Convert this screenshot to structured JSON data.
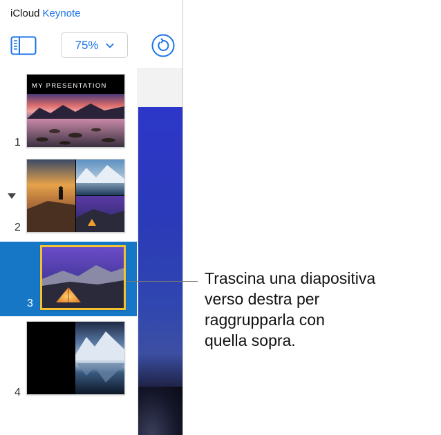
{
  "app": {
    "brand": "iCloud",
    "product": "Keynote"
  },
  "toolbar": {
    "zoom_value": "75%"
  },
  "slides": [
    {
      "number": "1",
      "title": "MY PRESENTATION"
    },
    {
      "number": "2"
    },
    {
      "number": "3",
      "selected": true
    },
    {
      "number": "4"
    }
  ],
  "callout": {
    "lines": [
      "Trascina una diapositiva",
      "verso destra per",
      "raggrupparla con",
      "quella sopra."
    ]
  },
  "colors": {
    "accent": "#1a73e8",
    "selection": "#1677c7",
    "active_border": "#f2c230"
  },
  "icons": [
    "sidebar-toggle-icon",
    "chevron-down-icon",
    "revert-icon",
    "disclosure-triangle-icon"
  ]
}
